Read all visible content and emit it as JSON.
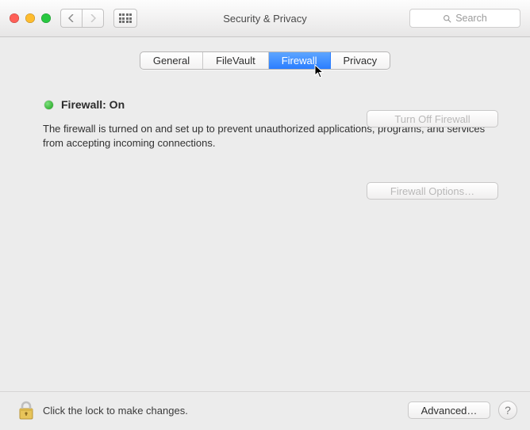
{
  "window": {
    "title": "Security & Privacy"
  },
  "search": {
    "placeholder": "Search"
  },
  "tabs": {
    "general": "General",
    "filevault": "FileVault",
    "firewall": "Firewall",
    "privacy": "Privacy",
    "active": "firewall"
  },
  "firewall": {
    "status_label": "Firewall: On",
    "status_color": "#18a018",
    "description": "The firewall is turned on and set up to prevent unauthorized applications, programs, and services from accepting incoming connections.",
    "turn_off_label": "Turn Off Firewall",
    "options_label": "Firewall Options…"
  },
  "footer": {
    "lock_hint": "Click the lock to make changes.",
    "advanced_label": "Advanced…"
  }
}
